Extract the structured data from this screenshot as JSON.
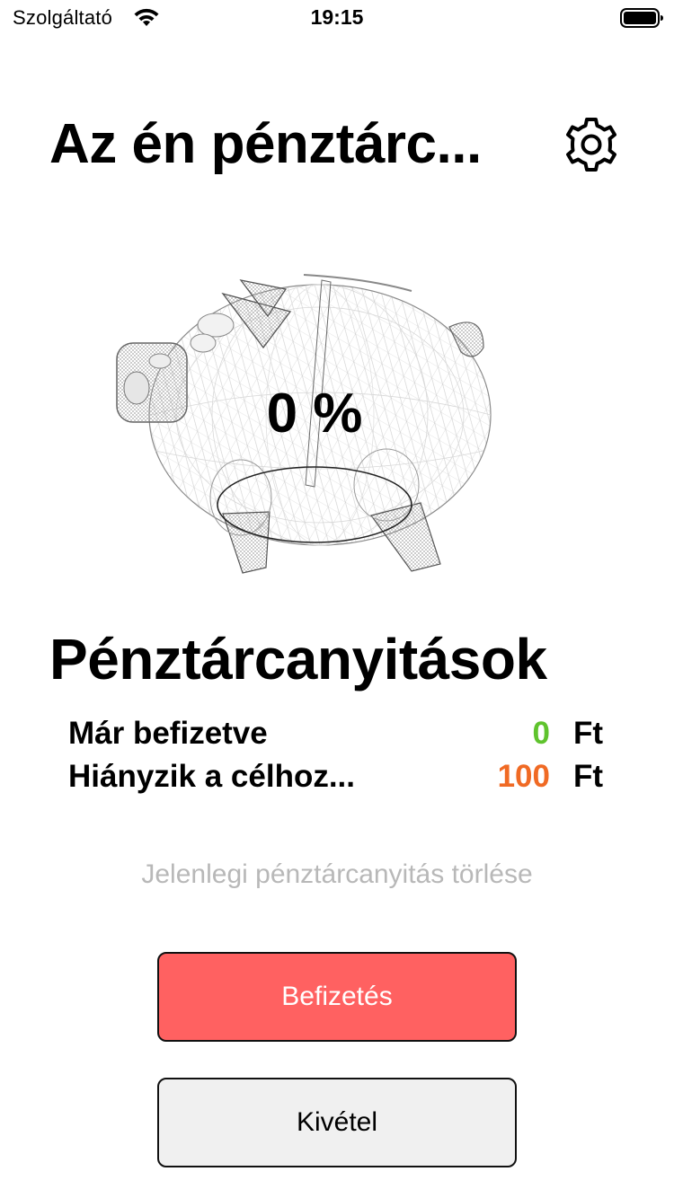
{
  "status_bar": {
    "carrier": "Szolgáltató",
    "time": "19:15"
  },
  "header": {
    "title": "Az én pénztárc...",
    "settings_icon": "gear-icon"
  },
  "piggy": {
    "percent_label": "0 %",
    "progress": 0
  },
  "section": {
    "title": "Pénztárcanyitások",
    "rows": [
      {
        "label": "Már befizetve",
        "value": "0",
        "unit": "Ft",
        "color": "#5fc32d"
      },
      {
        "label": "Hiányzik a célhoz...",
        "value": "100",
        "unit": "Ft",
        "color": "#f06a24"
      }
    ]
  },
  "actions": {
    "reset_label": "Jelenlegi pénztárcanyitás törlése",
    "deposit_label": "Befizetés",
    "withdraw_label": "Kivétel"
  },
  "colors": {
    "deposit_bg": "#ff6161",
    "withdraw_bg": "#f0f0f0",
    "muted_text": "#b8b8b8"
  }
}
